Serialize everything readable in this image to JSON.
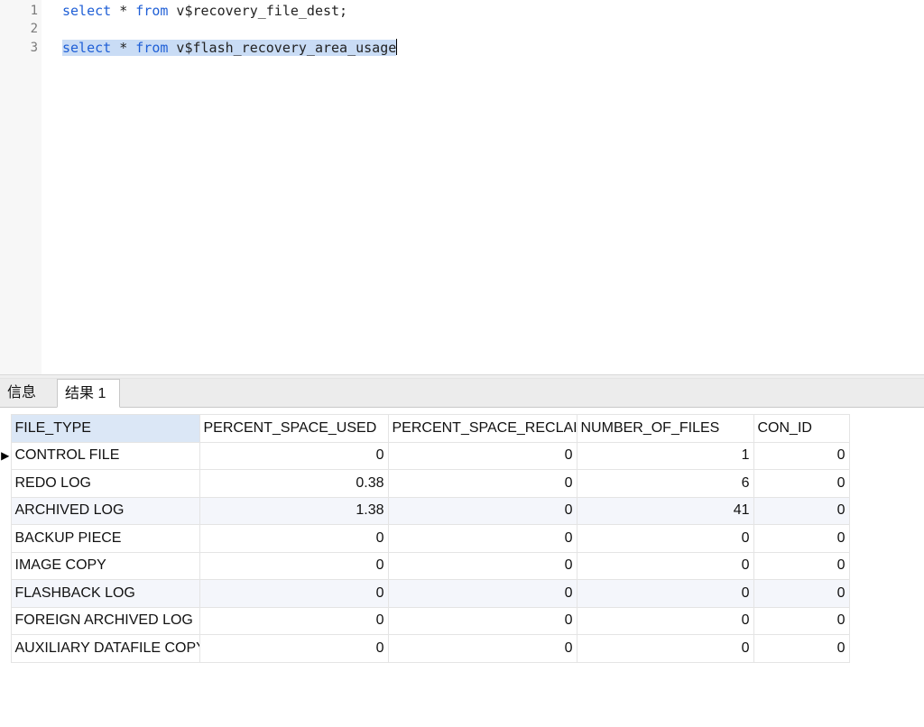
{
  "editor": {
    "line_numbers": [
      "1",
      "2",
      "3"
    ],
    "lines": [
      {
        "kw1": "select",
        "mid": " * ",
        "kw2": "from",
        "rest": " v$recovery_file_dest;"
      },
      {
        "kw1": "",
        "mid": "",
        "kw2": "",
        "rest": ""
      },
      {
        "kw1": "select",
        "mid": " * ",
        "kw2": "from",
        "rest": " v$flash_recovery_area_usage"
      }
    ]
  },
  "tabs": {
    "info": "信息",
    "result": "结果 1"
  },
  "grid": {
    "columns": [
      "FILE_TYPE",
      "PERCENT_SPACE_USED",
      "PERCENT_SPACE_RECLAIMABLE",
      "NUMBER_OF_FILES",
      "CON_ID"
    ],
    "rows": [
      [
        "CONTROL FILE",
        "0",
        "0",
        "1",
        "0"
      ],
      [
        "REDO LOG",
        "0.38",
        "0",
        "6",
        "0"
      ],
      [
        "ARCHIVED LOG",
        "1.38",
        "0",
        "41",
        "0"
      ],
      [
        "BACKUP PIECE",
        "0",
        "0",
        "0",
        "0"
      ],
      [
        "IMAGE COPY",
        "0",
        "0",
        "0",
        "0"
      ],
      [
        "FLASHBACK LOG",
        "0",
        "0",
        "0",
        "0"
      ],
      [
        "FOREIGN ARCHIVED LOG",
        "0",
        "0",
        "0",
        "0"
      ],
      [
        "AUXILIARY DATAFILE COPY",
        "0",
        "0",
        "0",
        "0"
      ]
    ],
    "current_row_indicator": "▶"
  }
}
